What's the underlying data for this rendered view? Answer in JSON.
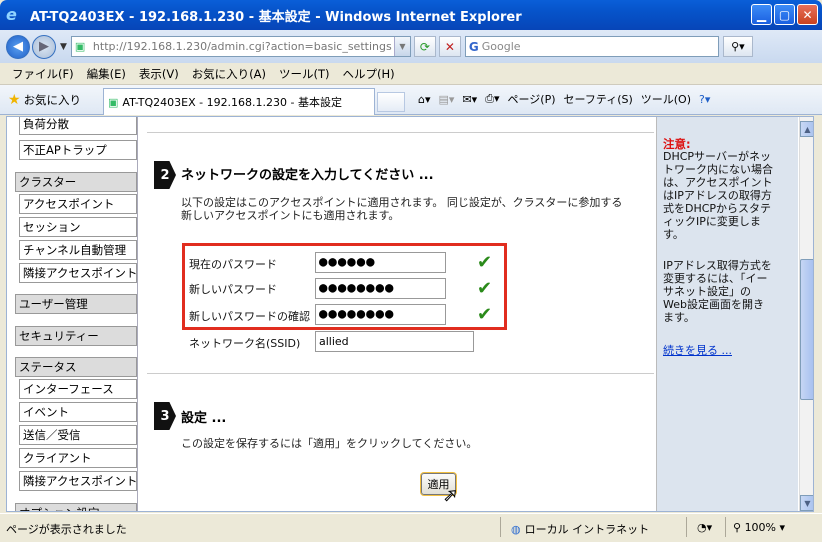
{
  "window": {
    "title": "AT-TQ2403EX - 192.168.1.230 - 基本設定 - Windows Internet Explorer"
  },
  "address": {
    "url": "http://192.168.1.230/admin.cgi?action=basic_settings",
    "search_placeholder": "Google"
  },
  "menu": [
    "ファイル(F)",
    "編集(E)",
    "表示(V)",
    "お気に入り(A)",
    "ツール(T)",
    "ヘルプ(H)"
  ],
  "tabbar": {
    "favorites": "お気に入り",
    "tab_title": "AT-TQ2403EX - 192.168.1.230 - 基本設定",
    "page_menu": "ページ(P)",
    "safety_menu": "セーフティ(S)",
    "tools_menu": "ツール(O)"
  },
  "sidebar": {
    "items_top": [
      "負荷分散",
      "不正APトラップ"
    ],
    "cluster_head": "クラスター",
    "cluster_items": [
      "アクセスポイント",
      "セッション",
      "チャンネル自動管理",
      "隣接アクセスポイント"
    ],
    "user_head": "ユーザー管理",
    "security_head": "セキュリティー",
    "status_head": "ステータス",
    "status_items": [
      "インターフェース",
      "イベント",
      "送信／受信",
      "クライアント",
      "隣接アクセスポイント"
    ],
    "options_head": "オプション設定"
  },
  "step2": {
    "number": "2",
    "title": "ネットワークの設定を入力してください ...",
    "desc1": "以下の設定はこのアクセスポイントに適用されます。 同じ設定が、クラスターに参加する",
    "desc2": "新しいアクセスポイントにも適用されます。",
    "current_pw_label": "現在のパスワード",
    "current_pw_value": "●●●●●●",
    "new_pw_label": "新しいパスワード",
    "new_pw_value": "●●●●●●●●",
    "confirm_pw_label": "新しいパスワードの確認",
    "confirm_pw_value": "●●●●●●●●",
    "network_name_label": "ネットワーク名(SSID)",
    "network_name_value": "allied"
  },
  "step3": {
    "number": "3",
    "title": "設定 ...",
    "desc": "この設定を保存するには「適用」をクリックしてください。",
    "apply_label": "適用"
  },
  "help": {
    "title": "注意:",
    "text1": "DHCPサーバーがネットワーク内にない場合は、アクセスポイントはIPアドレスの取得方式をDHCPからスタティックIPに変更します。",
    "text2": "IPアドレス取得方式を変更するには、「イーサネット設定」のWeb設定画面を開きます。",
    "more_link": "続きを見る ..."
  },
  "status": {
    "text": "ページが表示されました",
    "zone": "ローカル イントラネット",
    "zoom": "100%"
  },
  "colors": {
    "highlight_border": "#e12d1f",
    "check": "#2a8a1a",
    "help_title": "#dd1111",
    "titlebar": "#0653c9"
  }
}
